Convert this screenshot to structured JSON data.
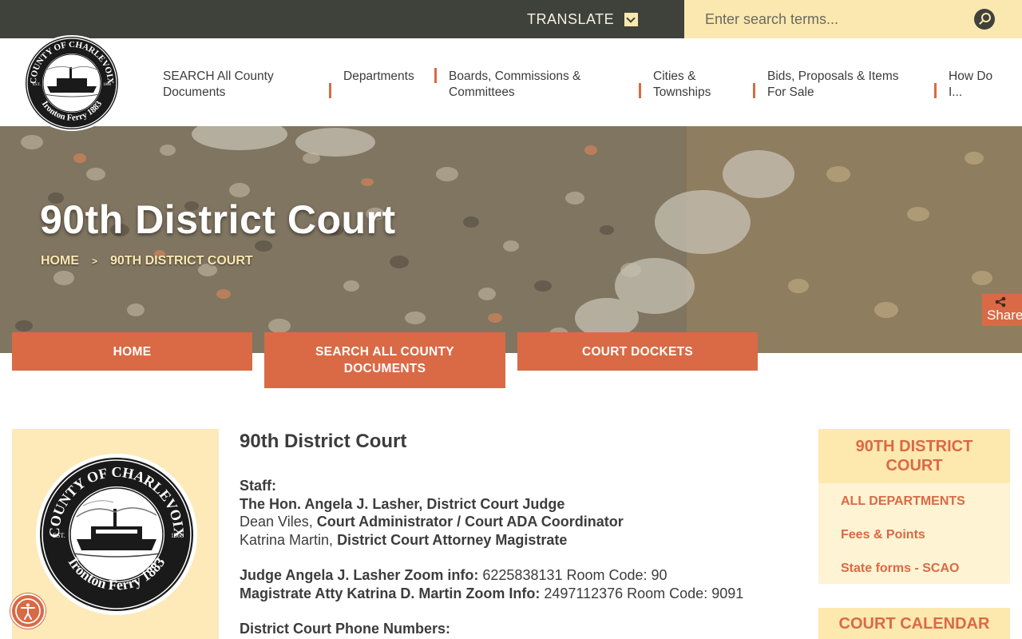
{
  "topbar": {
    "translate_label": "TRANSLATE",
    "search_placeholder": "Enter search terms..."
  },
  "nav": {
    "items": [
      {
        "label": "SEARCH All County Documents"
      },
      {
        "label": "Departments"
      },
      {
        "label": "Boards, Commissions & Committees"
      },
      {
        "label": "Cities & Townships"
      },
      {
        "label": "Bids, Proposals & Items For Sale"
      },
      {
        "label": "How Do I..."
      }
    ]
  },
  "logo": {
    "top_text": "COUNTY OF CHARLEVOIX",
    "bottom_text": "Ironton Ferry 1883",
    "est": "EST.",
    "year": "1868"
  },
  "hero": {
    "title": "90th District Court",
    "breadcrumb": [
      "HOME",
      "90TH DISTRICT COURT"
    ],
    "breadcrumb_sep": ">",
    "share_label": "Share"
  },
  "quick_buttons": [
    {
      "label": "HOME"
    },
    {
      "label": "SEARCH ALL COUNTY DOCUMENTS"
    },
    {
      "label": "COURT DOCKETS"
    }
  ],
  "content": {
    "heading": "90th District Court",
    "staff_label": "Staff:",
    "judge": "The Hon. Angela J. Lasher, District Court Judge",
    "admin_name": "Dean Viles,",
    "admin_title": "Court Administrator / Court ADA Coordinator",
    "magistrate_name": "Katrina Martin,",
    "magistrate_title": "District Court Attorney Magistrate",
    "judge_zoom_label": "Judge Angela J. Lasher Zoom info:",
    "judge_zoom_value": "6225838131 Room Code: 90",
    "mag_zoom_label": "Magistrate Atty Katrina D. Martin Zoom Info:",
    "mag_zoom_value": "2497112376 Room Code: 9091",
    "phones_label": "District Court Phone Numbers:"
  },
  "sidebar": {
    "title_line1": "90TH DISTRICT",
    "title_line2": "COURT",
    "links": [
      {
        "label": "ALL DEPARTMENTS"
      },
      {
        "label": "Fees & Points"
      },
      {
        "label": "State forms - SCAO"
      }
    ],
    "calendar_title": "COURT CALENDAR"
  },
  "colors": {
    "accent": "#d96a45",
    "cream": "#fbe8b0",
    "dark": "#3f423b"
  },
  "icons": [
    "chevron-down-icon",
    "search-icon",
    "share-icon",
    "accessibility-icon"
  ]
}
